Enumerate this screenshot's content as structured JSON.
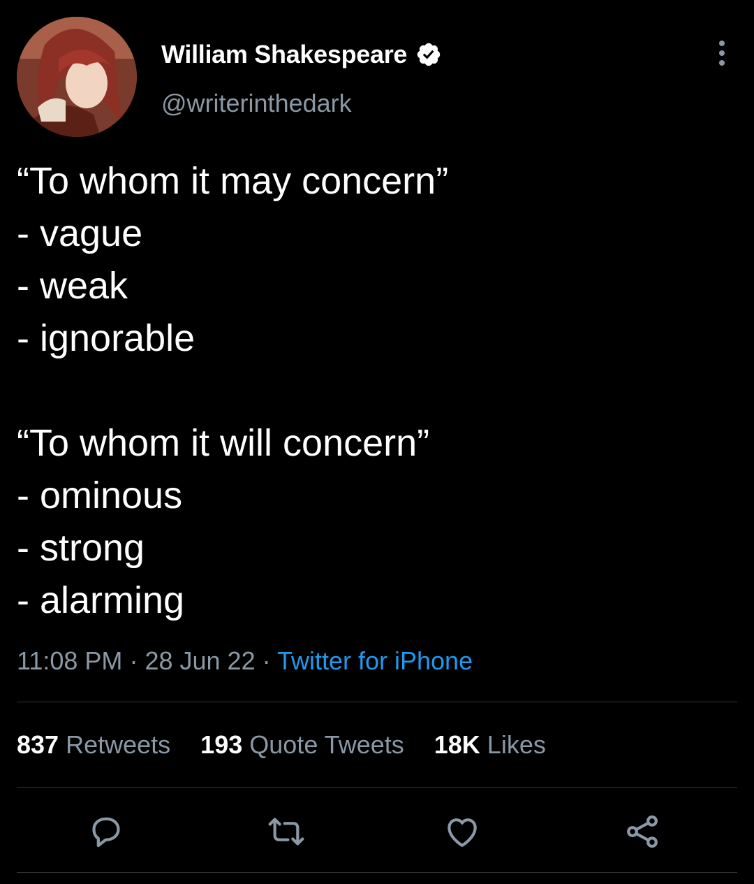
{
  "author": {
    "display_name": "William Shakespeare",
    "handle": "@writerinthedark",
    "verified": true
  },
  "tweet": {
    "lines": [
      "“To whom it may concern”",
      "- vague",
      "- weak",
      "- ignorable",
      "",
      "“To whom it will concern”",
      "- ominous",
      "- strong",
      "- alarming"
    ],
    "time": "11:08 PM",
    "date": "28 Jun 22",
    "separator": "·",
    "source": "Twitter for iPhone"
  },
  "stats": {
    "retweets": {
      "count": "837",
      "label": "Retweets"
    },
    "quote_tweets": {
      "count": "193",
      "label": "Quote Tweets"
    },
    "likes": {
      "count": "18K",
      "label": "Likes"
    }
  },
  "actions": [
    "reply-icon",
    "retweet-icon",
    "like-icon",
    "share-icon"
  ],
  "colors": {
    "background": "#000000",
    "text": "#ffffff",
    "secondary": "#8b98a5",
    "link": "#1d9bf0",
    "divider": "#2f3336"
  }
}
